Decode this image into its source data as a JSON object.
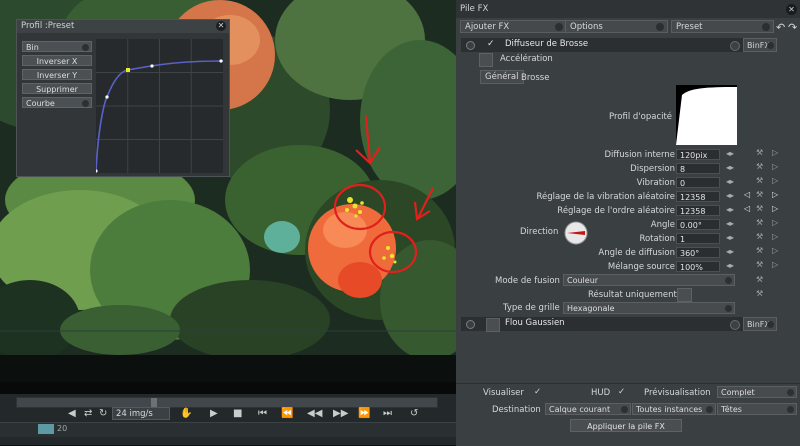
{
  "profile_panel": {
    "title": "Profil :Preset",
    "buttons": [
      "Bin",
      "Inverser X",
      "Inverser Y",
      "Supprimer",
      "Courbe"
    ]
  },
  "timeline": {
    "fps": "24 img/s",
    "frame": "20"
  },
  "fx_panel": {
    "title": "Pile FX",
    "toolbar": {
      "add_fx": "Ajouter FX",
      "options": "Options",
      "preset": "Preset"
    },
    "effect1": {
      "name": "Diffuseur de Brosse",
      "binfx": "BinFX",
      "acceleration": "Accélération"
    },
    "tabs": [
      "Général",
      "Brosse"
    ],
    "opacity_profile_label": "Profil d'opacité",
    "params": [
      {
        "label": "Diffusion interne",
        "value": "120pix"
      },
      {
        "label": "Dispersion",
        "value": "8"
      },
      {
        "label": "Vibration",
        "value": "0"
      },
      {
        "label": "Réglage de la vibration aléatoire",
        "value": "12358"
      },
      {
        "label": "Réglage de l'ordre aléatoire",
        "value": "12358"
      },
      {
        "label": "Angle",
        "value": "0.00°"
      },
      {
        "label": "Rotation",
        "value": "1"
      },
      {
        "label": "Angle de diffusion",
        "value": "360°"
      },
      {
        "label": "Mélange source",
        "value": "100%"
      }
    ],
    "direction_label": "Direction",
    "blend_mode_label": "Mode de fusion",
    "blend_mode_value": "Couleur",
    "unique_result_label": "Résultat uniquement",
    "grid_type_label": "Type de grille",
    "grid_type_value": "Hexagonale",
    "effect2": {
      "name": "Flou Gaussien",
      "binfx": "BinFX"
    },
    "bottom": {
      "visualiser": "Visualiser",
      "hud": "HUD",
      "preview_label": "Prévisualisation",
      "preview_value": "Complet",
      "destination_label": "Destination",
      "destination_value": "Calque courant",
      "instances_value": "Toutes instances",
      "heads_value": "Têtes",
      "apply": "Appliquer la pile FX"
    }
  },
  "colors": {
    "accent_red": "#e0201c",
    "canvas_orange": "#f0693c",
    "curve_blue": "#5a62c8"
  }
}
